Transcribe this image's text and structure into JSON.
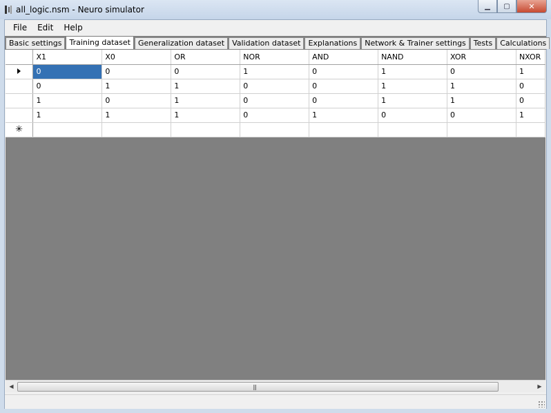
{
  "window": {
    "title": "all_logic.nsm - Neuro simulator",
    "minimize_glyph": "▁",
    "maximize_glyph": "▢",
    "close_glyph": "✕"
  },
  "menu": [
    "File",
    "Edit",
    "Help"
  ],
  "tabs": [
    {
      "label": "Basic settings",
      "active": false
    },
    {
      "label": "Training dataset",
      "active": true
    },
    {
      "label": "Generalization dataset",
      "active": false
    },
    {
      "label": "Validation dataset",
      "active": false
    },
    {
      "label": "Explanations",
      "active": false
    },
    {
      "label": "Network & Trainer settings",
      "active": false
    },
    {
      "label": "Tests",
      "active": false
    },
    {
      "label": "Calculations",
      "active": false
    }
  ],
  "grid": {
    "columns": [
      "X1",
      "X0",
      "OR",
      "NOR",
      "AND",
      "NAND",
      "XOR",
      "NXOR"
    ],
    "rows": [
      [
        "0",
        "0",
        "0",
        "1",
        "0",
        "1",
        "0",
        "1"
      ],
      [
        "0",
        "1",
        "1",
        "0",
        "0",
        "1",
        "1",
        "0"
      ],
      [
        "1",
        "0",
        "1",
        "0",
        "0",
        "1",
        "1",
        "0"
      ],
      [
        "1",
        "1",
        "1",
        "0",
        "1",
        "0",
        "0",
        "1"
      ]
    ],
    "new_row_marker": "✳",
    "scroll_grip": "|||",
    "scroll_left": "◀",
    "scroll_right": "▶"
  },
  "colors": {
    "selection": "#3471b4",
    "empty_area": "#808080"
  }
}
